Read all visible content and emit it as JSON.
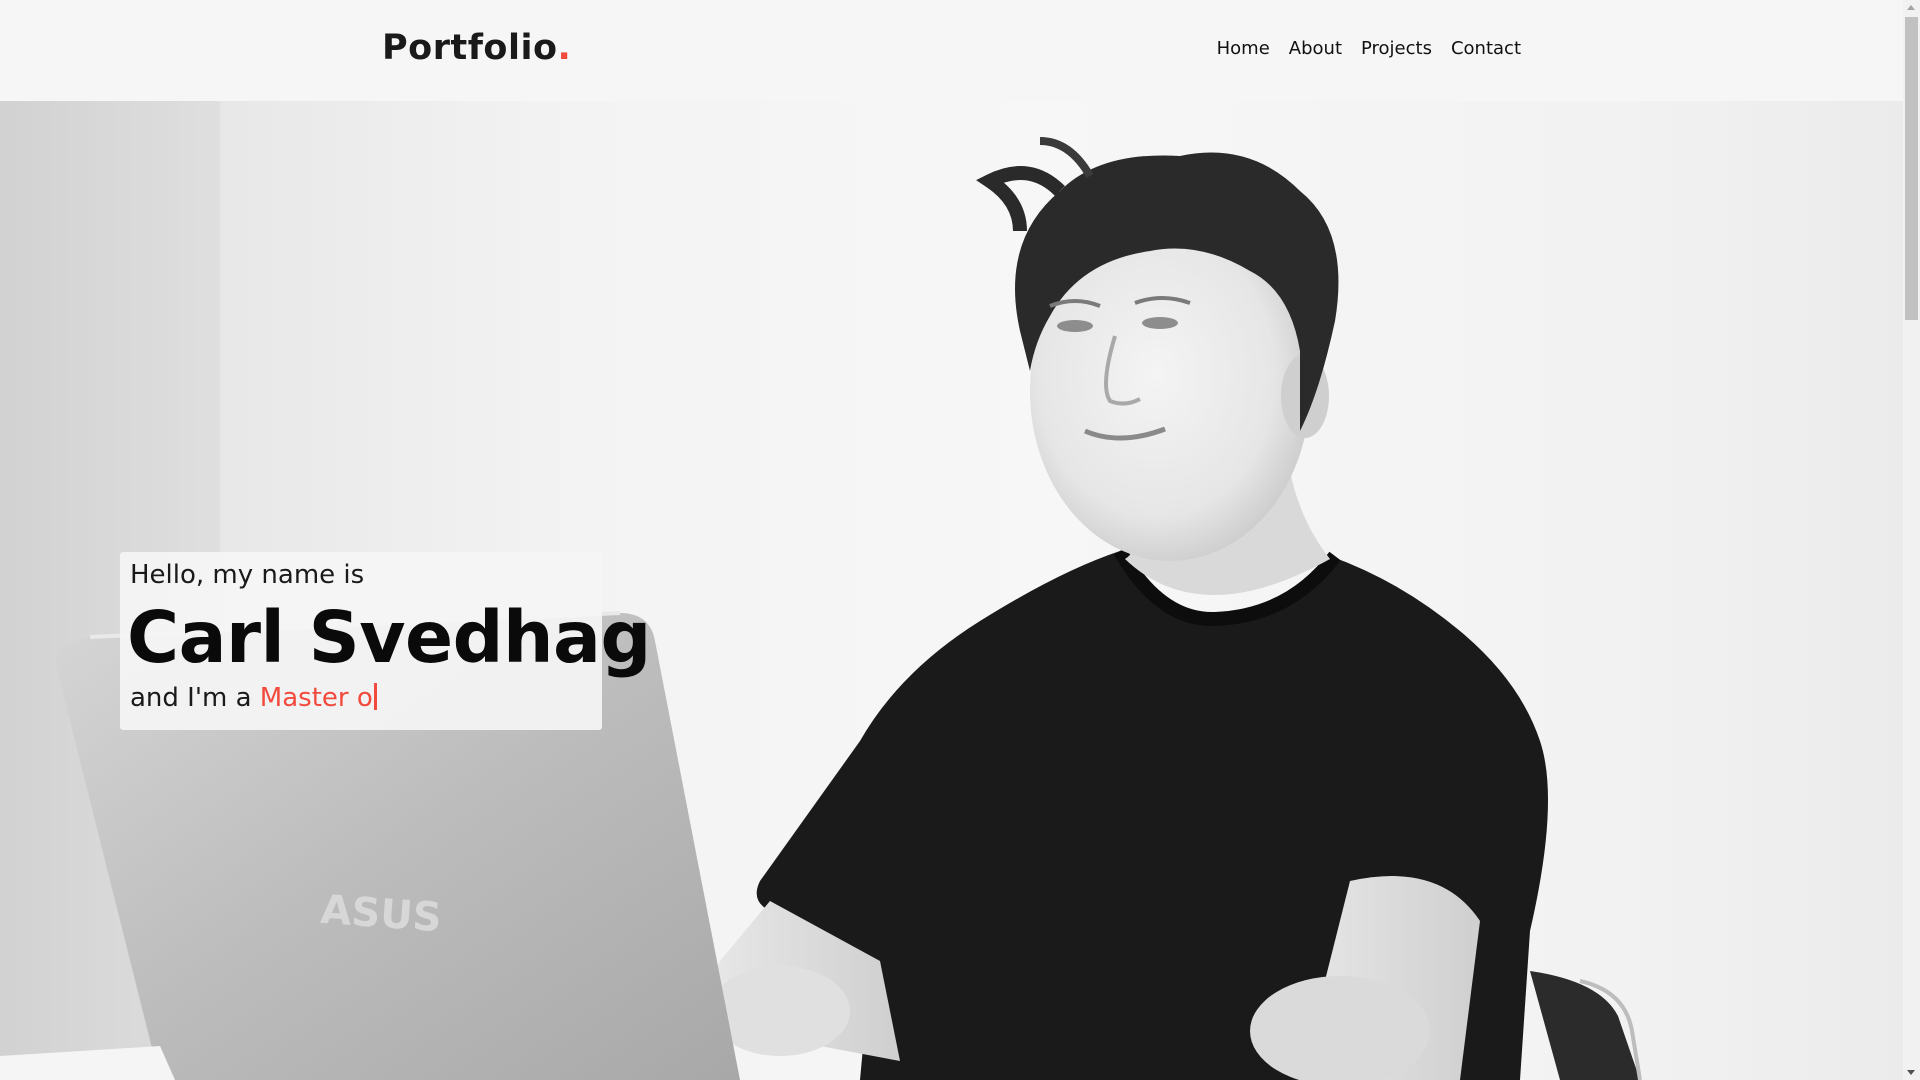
{
  "navbar": {
    "brand": "Portfolio",
    "brand_dot": ".",
    "links": [
      "Home",
      "About",
      "Projects",
      "Contact"
    ]
  },
  "hero": {
    "greeting": "Hello, my name is",
    "name": "Carl Svedhag",
    "role_prefix": "and I'm a ",
    "role_typed": "Master o",
    "photo_icon": "portrait-photo"
  },
  "colors": {
    "accent": "#f24a3d",
    "text": "#111111",
    "navbar_bg": "#f6f6f6"
  }
}
